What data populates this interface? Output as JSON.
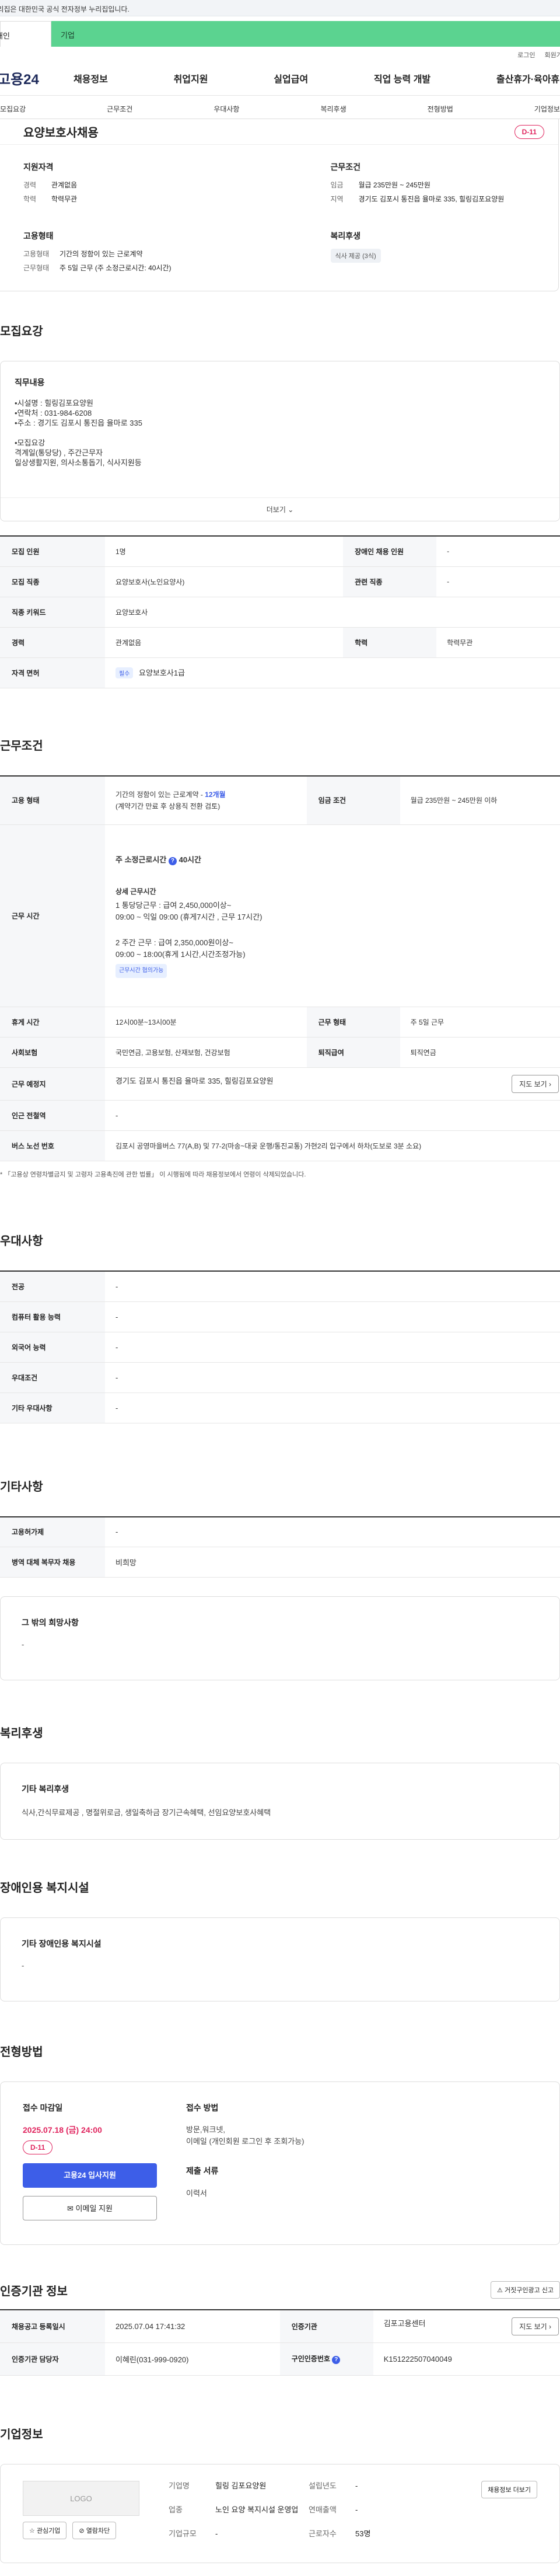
{
  "gov_notice": "이 누리집은 대한민국 공식 전자정부 누리집입니다.",
  "tabs": {
    "personal": "개인",
    "company": "기업"
  },
  "top_links": {
    "login": "로그인",
    "join": "회원가입"
  },
  "logo": "고용24",
  "gnb": [
    "채용정보",
    "취업지원",
    "실업급여",
    "직업 능력 개발",
    "출산휴가·육아휴직"
  ],
  "snb": [
    "모집요강",
    "근무조건",
    "우대사항",
    "복리후생",
    "전형방법",
    "기업정보"
  ],
  "job": {
    "title": "요양보호사채용",
    "dday": "D-11",
    "qual_title": "지원자격",
    "qual": [
      {
        "k": "경력",
        "v": "관계없음"
      },
      {
        "k": "학력",
        "v": "학력무관"
      }
    ],
    "cond_title": "근무조건",
    "cond": [
      {
        "k": "임금",
        "v": "월급 235만원 ~ 245만원"
      },
      {
        "k": "지역",
        "v": "경기도 김포시 통진읍 율마로 335, 힐링김포요양원"
      }
    ],
    "emp_title": "고용형태",
    "emp": [
      {
        "k": "고용형태",
        "v": "기간의 정함이 있는 근로계약"
      },
      {
        "k": "근무형태",
        "v": "주 5일 근무 (주 소정근로시간: 40시간)"
      }
    ],
    "welfare_title": "복리후생",
    "welfare_chip": "식사 제공 (3식)"
  },
  "recruit": {
    "heading": "모집요강",
    "duty_title": "직무내용",
    "duty_body": "•시설명 : 힐링김포요양원\n•연락처 : 031-984-6208\n•주소    : 경기도 김포시 통진읍 율마로 335\n\n•모집요강\n 격계일(통당당) , 주간근무자\n 일상생활지원, 의사소통돕기, 식사지원등",
    "more": "더보기",
    "rows": [
      {
        "h1": "모집 인원",
        "v1": "1명",
        "h2": "장애인 채용 인원",
        "v2": "-"
      },
      {
        "h1": "모집 직종",
        "v1": "요양보호사(노인요양사)",
        "h2": "관련 직종",
        "v2": "-"
      },
      {
        "h1": "직종 키워드",
        "v1": "요양보호사"
      },
      {
        "h1": "경력",
        "v1": "관계없음",
        "h2": "학력",
        "v2": "학력무관"
      }
    ],
    "license_label": "자격 면허",
    "license_badge": "필수",
    "license_value": "요양보호사1급"
  },
  "work": {
    "heading": "근무조건",
    "emp_label": "고용 형태",
    "emp_value": "기간의 정함이 있는 근로계약 - ",
    "emp_months": "12개월",
    "emp_sub": "(계약기간 만료 후 상용직 전환 검토)",
    "wage_label": "임금 조건",
    "wage_value": "월급 235만원 ~ 245만원 이하",
    "time_label": "근무 시간",
    "weekly": "주 소정근로시간",
    "weekly_hours": "40시간",
    "detail_title": "상세 근무시간",
    "d1": "1 통당당근무 : 급여 2,450,000이상~\n  09:00 ~ 익일 09:00 (휴게7시간 , 근무 17시간)",
    "d2": "2 주간  근무 : 급여 2,350,000원이상~\n  09:00 ~ 18:00(휴게 1시간,시간조정가능)",
    "flex_chip": "근무시간 협의가능",
    "break_label": "휴게 시간",
    "break_value": "12시00분~13시00분",
    "form_label": "근무 형태",
    "form_value": "주 5일 근무",
    "insure_label": "사회보험",
    "insure_value": "국민연금, 고용보험, 산재보험, 건강보험",
    "retire_label": "퇴직급여",
    "retire_value": "퇴직연금",
    "place_label": "근무 예정지",
    "place_value": "경기도 김포시 통진읍 율마로 335, 힐링김포요양원",
    "map_btn": "지도 보기",
    "station_label": "인근 전철역",
    "station_value": "-",
    "bus_label": "버스 노선 번호",
    "bus_value": "김포시 공영마을버스 77(A,B) 및 77-2(마송~대곶 운행/통진교통) 가현2리 입구에서 하차(도보로 3분 소요)",
    "note": "* 「고용상 연령차별금지 및 고령자 고용촉진에 관한 법률」 이 시행됨에 따라 채용정보에서 연령이 삭제되었습니다."
  },
  "pref": {
    "heading": "우대사항",
    "rows": [
      {
        "h": "전공",
        "v": "-"
      },
      {
        "h": "컴퓨터 활용 능력",
        "v": "-"
      },
      {
        "h": "외국어 능력",
        "v": "-"
      },
      {
        "h": "우대조건",
        "v": "-"
      },
      {
        "h": "기타 우대사항",
        "v": "-"
      }
    ]
  },
  "etc": {
    "heading": "기타사항",
    "rows": [
      {
        "h": "고용허가제",
        "v": "-"
      },
      {
        "h": "병역 대체 복무자 채용",
        "v": "비희망"
      }
    ],
    "box_title": "그 밖의 희망사항",
    "box_body": "-"
  },
  "welfare": {
    "heading": "복리후생",
    "box_title": "기타 복리후생",
    "box_body": "식사,간식무료제공 , 명절위로금, 생일축하금 장기근속혜택, 선임요양보호사혜택"
  },
  "disabled": {
    "heading": "장애인용 복지시설",
    "box_title": "기타 장애인용 복지시설",
    "box_body": "-"
  },
  "apply": {
    "heading": "전형방법",
    "deadline_title": "접수 마감일",
    "deadline": "2025.07.18 (금) 24:00",
    "dday": "D-11",
    "btn_apply": "고용24 입사지원",
    "btn_email": "이메일 지원",
    "method_title": "접수 방법",
    "method_body": "방문,워크넷,\n이메일 (개인회원 로그인 후 조회가능)",
    "docs_title": "제출 서류",
    "docs_body": "이력서"
  },
  "agency": {
    "heading": "인증기관 정보",
    "report_btn": "거짓구인광고 신고",
    "r1": {
      "h1": "채용공고 등록일시",
      "v1": "2025.07.04 17:41:32",
      "h2": "인증기관",
      "v2": "김포고용센터",
      "btn": "지도 보기"
    },
    "r2": {
      "h1": "인증기관 담당자",
      "v1": "이혜린(031-999-0920)",
      "h2": "구인인증번호",
      "v2": "K151222507040049"
    }
  },
  "company": {
    "heading": "기업정보",
    "logo": "LOGO",
    "fav_btn": "관심기업",
    "block_btn": "열람차단",
    "view_btn": "채용정보 더보기",
    "name_k": "기업명",
    "name_v": "힐링 김포요양원",
    "year_k": "설립년도",
    "year_v": "-",
    "biz_k": "업종",
    "biz_v": "노인 요양 복지시설 운영업",
    "sales_k": "연매출액",
    "sales_v": "-",
    "emp_k": "근로자수",
    "emp_v": "53명",
    "size_k": "기업규모",
    "size_v": "-"
  }
}
